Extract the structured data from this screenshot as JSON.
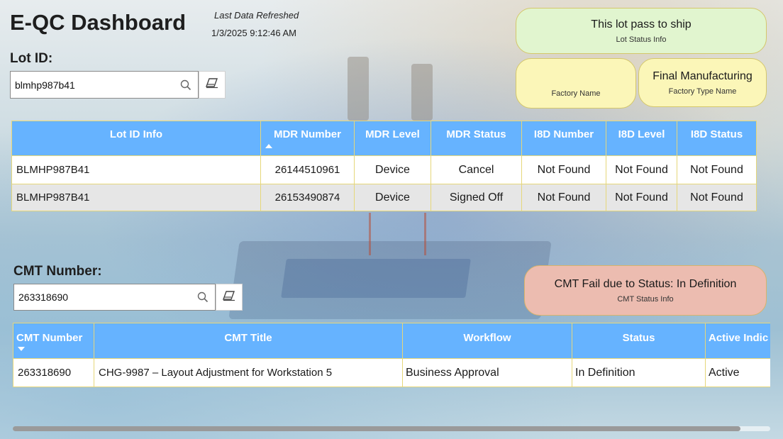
{
  "header": {
    "title": "E-QC Dashboard",
    "refresh_label": "Last Data Refreshed",
    "refresh_time": "1/3/2025 9:12:46 AM"
  },
  "lot": {
    "label": "Lot ID:",
    "value": "blmhp987b41"
  },
  "cards": {
    "lot_status": {
      "main": "This lot pass to ship",
      "sub": "Lot Status Info",
      "color": "#e1f5cf"
    },
    "factory_name": {
      "main": "",
      "sub": "Factory Name",
      "color": "#fbf6b8"
    },
    "factory_type": {
      "main": "Final Manufacturing",
      "sub": "Factory Type Name",
      "color": "#fbf6b8"
    },
    "cmt_status": {
      "main": "CMT Fail due to Status: In Definition",
      "sub": "CMT Status Info",
      "color": "#ecbcb0"
    }
  },
  "lot_table": {
    "columns": [
      "Lot ID Info",
      "MDR Number",
      "MDR Level",
      "MDR Status",
      "I8D Number",
      "I8D Level",
      "I8D Status"
    ],
    "rows": [
      [
        "BLMHP987B41",
        "26144510961",
        "Device",
        "Cancel",
        "Not Found",
        "Not Found",
        "Not Found"
      ],
      [
        "BLMHP987B41",
        "26153490874",
        "Device",
        "Signed Off",
        "Not Found",
        "Not Found",
        "Not Found"
      ]
    ]
  },
  "cmt": {
    "label": "CMT Number:",
    "value": "263318690"
  },
  "cmt_table": {
    "columns": [
      "CMT Number",
      "CMT Title",
      "Workflow",
      "Status",
      "Active Indic"
    ],
    "rows": [
      [
        "263318690",
        "CHG-9987 – Layout Adjustment for Workstation 5",
        "Business Approval",
        "In Definition",
        "Active"
      ]
    ]
  },
  "colors": {
    "header_blue": "#66b3ff",
    "border_gold": "#e6d77a",
    "row_alt": "#e6e6e6"
  },
  "icons": {
    "search": "search-icon",
    "erase": "eraser-icon",
    "sort_asc": "sort-ascending-icon",
    "sort_desc": "sort-descending-icon"
  }
}
